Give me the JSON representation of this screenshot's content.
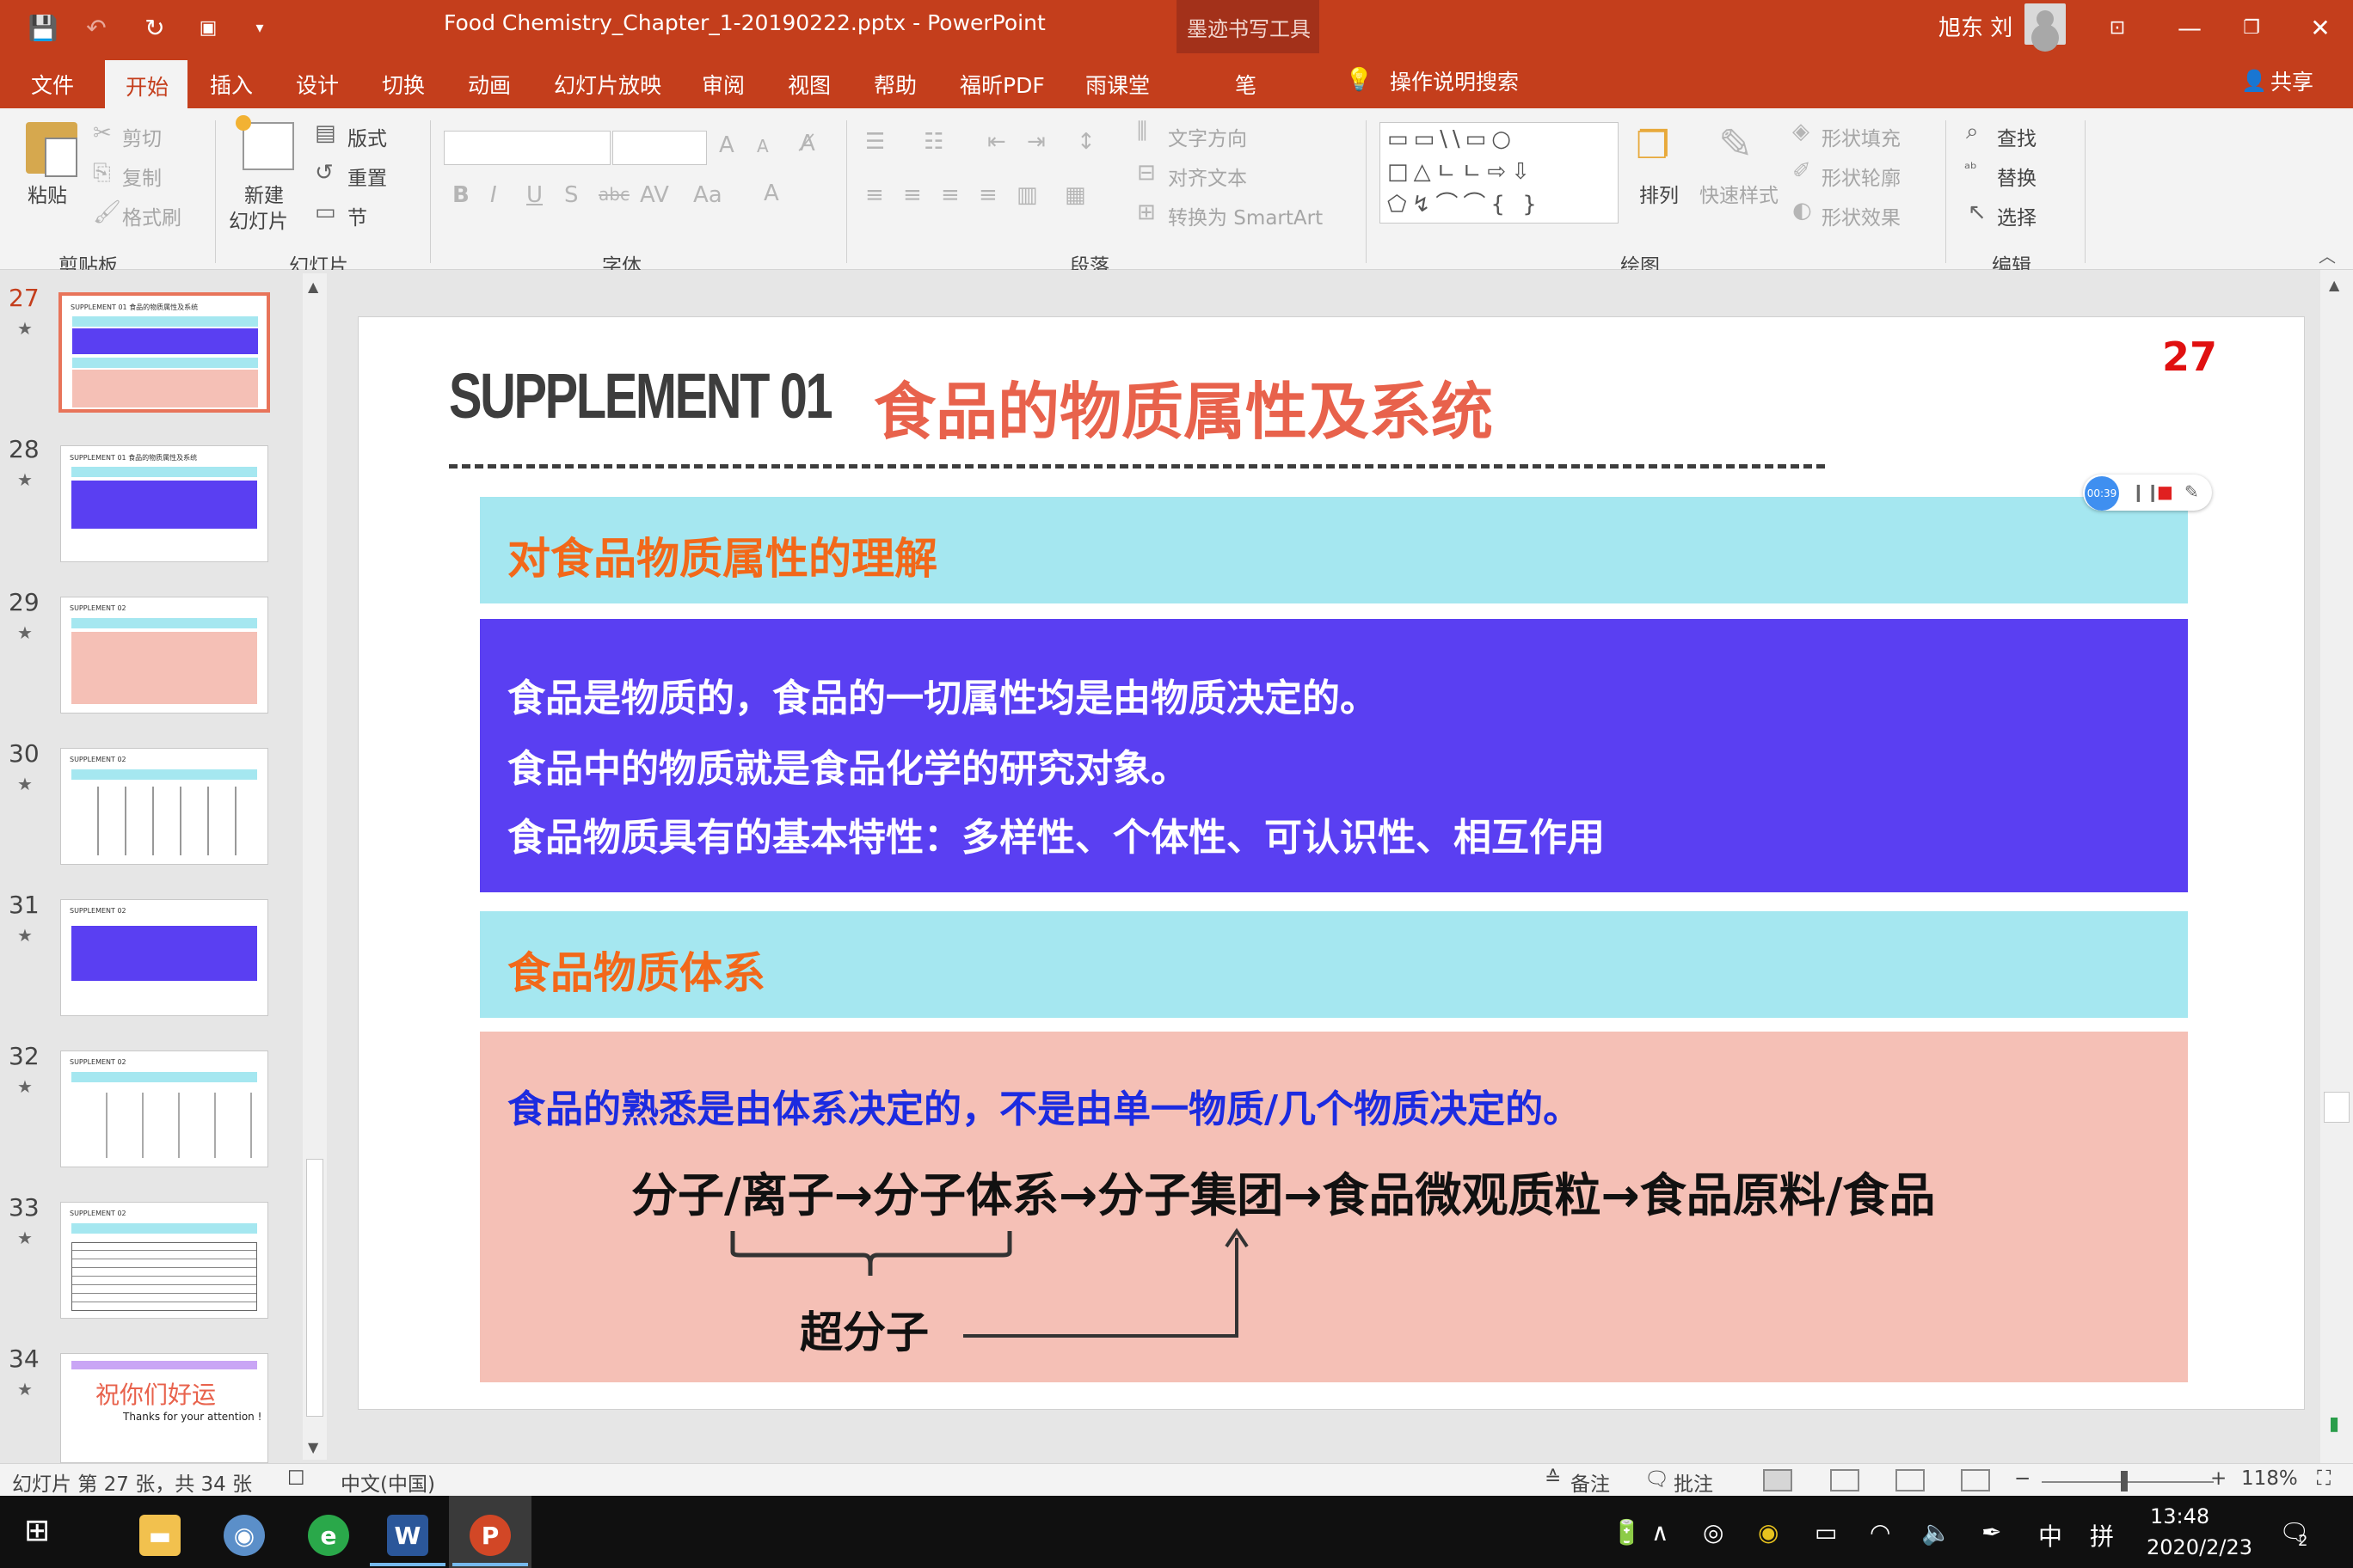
{
  "app": {
    "document_title": "Food Chemistry_Chapter_1-20190222.pptx - PowerPoint",
    "contextual_tools": "墨迹书写工具",
    "user_name": "旭东 刘"
  },
  "tabs": [
    {
      "label": "文件"
    },
    {
      "label": "开始"
    },
    {
      "label": "插入"
    },
    {
      "label": "设计"
    },
    {
      "label": "切换"
    },
    {
      "label": "动画"
    },
    {
      "label": "幻灯片放映"
    },
    {
      "label": "审阅"
    },
    {
      "label": "视图"
    },
    {
      "label": "帮助"
    },
    {
      "label": "福昕PDF"
    },
    {
      "label": "雨课堂"
    },
    {
      "label": "笔"
    }
  ],
  "tell_me": "操作说明搜索",
  "share_label": "共享",
  "ribbon": {
    "clipboard": {
      "paste": "粘贴",
      "cut": "剪切",
      "copy": "复制",
      "format_painter": "格式刷",
      "group": "剪贴板"
    },
    "slides": {
      "new_slide_line1": "新建",
      "new_slide_line2": "幻灯片",
      "layout": "版式",
      "reset": "重置",
      "section": "节",
      "group": "幻灯片"
    },
    "font": {
      "group": "字体"
    },
    "paragraph": {
      "text_direction": "文字方向",
      "align_text": "对齐文本",
      "smartart": "转换为 SmartArt",
      "group": "段落"
    },
    "drawing": {
      "arrange": "排列",
      "quick_styles": "快速样式",
      "shape_fill": "形状填充",
      "shape_outline": "形状轮廓",
      "shape_effects": "形状效果",
      "group": "绘图"
    },
    "editing": {
      "find": "查找",
      "replace": "替换",
      "select": "选择",
      "group": "编辑"
    }
  },
  "thumbnails": [
    {
      "number": "27",
      "title": "SUPPLEMENT 01 食品的物质属性及系统"
    },
    {
      "number": "28",
      "title": "SUPPLEMENT 01 食品的物质属性及系统"
    },
    {
      "number": "29",
      "title": "SUPPLEMENT 02"
    },
    {
      "number": "30",
      "title": "SUPPLEMENT 02"
    },
    {
      "number": "31",
      "title": "SUPPLEMENT 02"
    },
    {
      "number": "32",
      "title": "SUPPLEMENT 02"
    },
    {
      "number": "33",
      "title": "SUPPLEMENT 02"
    },
    {
      "number": "34",
      "title": "祝你们好运",
      "subtitle": "Thanks for your attention !"
    }
  ],
  "slide": {
    "title_en": "SUPPLEMENT 01",
    "title_cn": "食品的物质属性及系统",
    "page_number": "27",
    "section1_heading": "对食品物质属性的理解",
    "section1_lines": [
      "食品是物质的，食品的一切属性均是由物质决定的。",
      "食品中的物质就是食品化学的研究对象。",
      "食品物质具有的基本特性：多样性、个体性、可认识性、相互作用"
    ],
    "section2_heading": "食品物质体系",
    "section2_lead": "食品的熟悉是由体系决定的，不是由单一物质/几个物质决定的。",
    "chain": "分子/离子→分子体系→分子集团→食品微观质粒→食品原料/食品",
    "supramolecule": "超分子"
  },
  "recorder": {
    "time": "00:39"
  },
  "status": {
    "slide_info": "幻灯片 第 27 张，共 34 张",
    "language": "中文(中国)",
    "notes": "备注",
    "comments": "批注",
    "zoom": "118%"
  },
  "taskbar": {
    "time": "13:48",
    "date": "2020/2/23",
    "ime": "中",
    "notification_count": "2"
  },
  "colors": {
    "accent": "#c43e1c",
    "slide_title_cn": "#e8624c",
    "cyan_band": "#a5e7f0",
    "blue_band": "#5a3ff2",
    "pink_band": "#f5c0b6",
    "heading_orange": "#f2681a",
    "lead_blue": "#1c2be0"
  }
}
